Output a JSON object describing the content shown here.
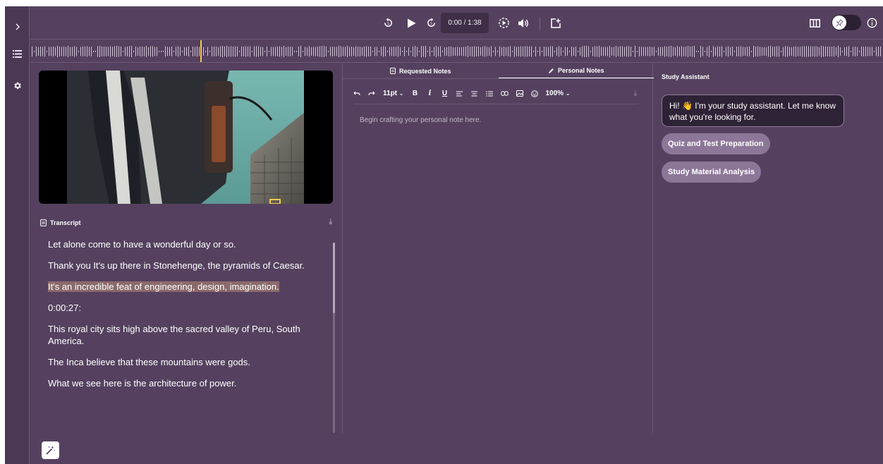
{
  "player": {
    "time": "0:00 / 1:38"
  },
  "transcript": {
    "title": "Transcript",
    "lines": [
      {
        "text": "Let alone come to have a wonderful day or so."
      },
      {
        "text": "Thank you It's up there in Stonehenge, the pyramids of Caesar."
      },
      {
        "text": "It's an incredible feat of engineering, design, imagination."
      },
      {
        "text": "0:00:27:"
      },
      {
        "text": "This royal city sits high above the sacred valley of Peru, South America."
      },
      {
        "text": "The Inca believe that these mountains were gods."
      },
      {
        "text": "What we see here is the architecture of power."
      }
    ]
  },
  "notes": {
    "tabs": [
      {
        "label": "Requested Notes",
        "icon": "document-icon"
      },
      {
        "label": "Personal Notes",
        "icon": "pencil-icon"
      }
    ],
    "toolbar": {
      "font_size": "11pt",
      "bold": "B",
      "italic": "i",
      "underline": "U",
      "zoom": "100%"
    },
    "placeholder": "Begin crafting your personal note here."
  },
  "assistant": {
    "title": "Study Assistant",
    "greeting": "Hi! 👋 I'm your study assistant. Let me know what you're looking for.",
    "chips": [
      "Quiz and Test Preparation",
      "Study Material Analysis"
    ]
  },
  "colors": {
    "background": "#55415f",
    "rail": "#4a3854",
    "accent": "#f2c94c",
    "chip": "#8d7798",
    "highlight": "#8b6a6a"
  }
}
